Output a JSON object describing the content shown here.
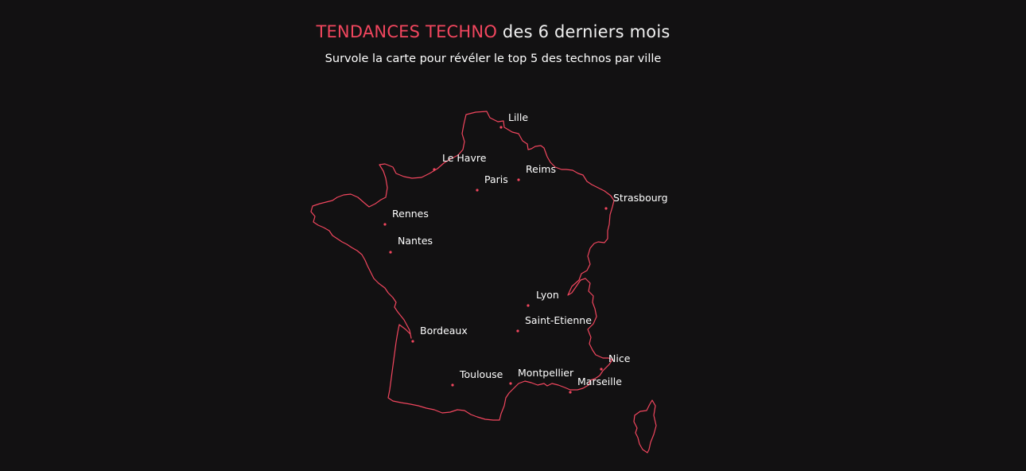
{
  "header": {
    "title_accent": "TENDANCES TECHNO",
    "title_rest": " des 6 derniers mois",
    "subtitle": "Survole la carte pour révéler le top 5 des technos par ville"
  },
  "colors": {
    "background": "#121112",
    "accent": "#f1465e",
    "text": "#ffffff"
  },
  "cities": [
    {
      "id": "lille",
      "name": "Lille"
    },
    {
      "id": "le-havre",
      "name": "Le Havre"
    },
    {
      "id": "reims",
      "name": "Reims"
    },
    {
      "id": "paris",
      "name": "Paris"
    },
    {
      "id": "strasbourg",
      "name": "Strasbourg"
    },
    {
      "id": "rennes",
      "name": "Rennes"
    },
    {
      "id": "nantes",
      "name": "Nantes"
    },
    {
      "id": "lyon",
      "name": "Lyon"
    },
    {
      "id": "saint-etienne",
      "name": "Saint-Etienne"
    },
    {
      "id": "bordeaux",
      "name": "Bordeaux"
    },
    {
      "id": "nice",
      "name": "Nice"
    },
    {
      "id": "toulouse",
      "name": "Toulouse"
    },
    {
      "id": "montpellier",
      "name": "Montpellier"
    },
    {
      "id": "marseille",
      "name": "Marseille"
    }
  ]
}
